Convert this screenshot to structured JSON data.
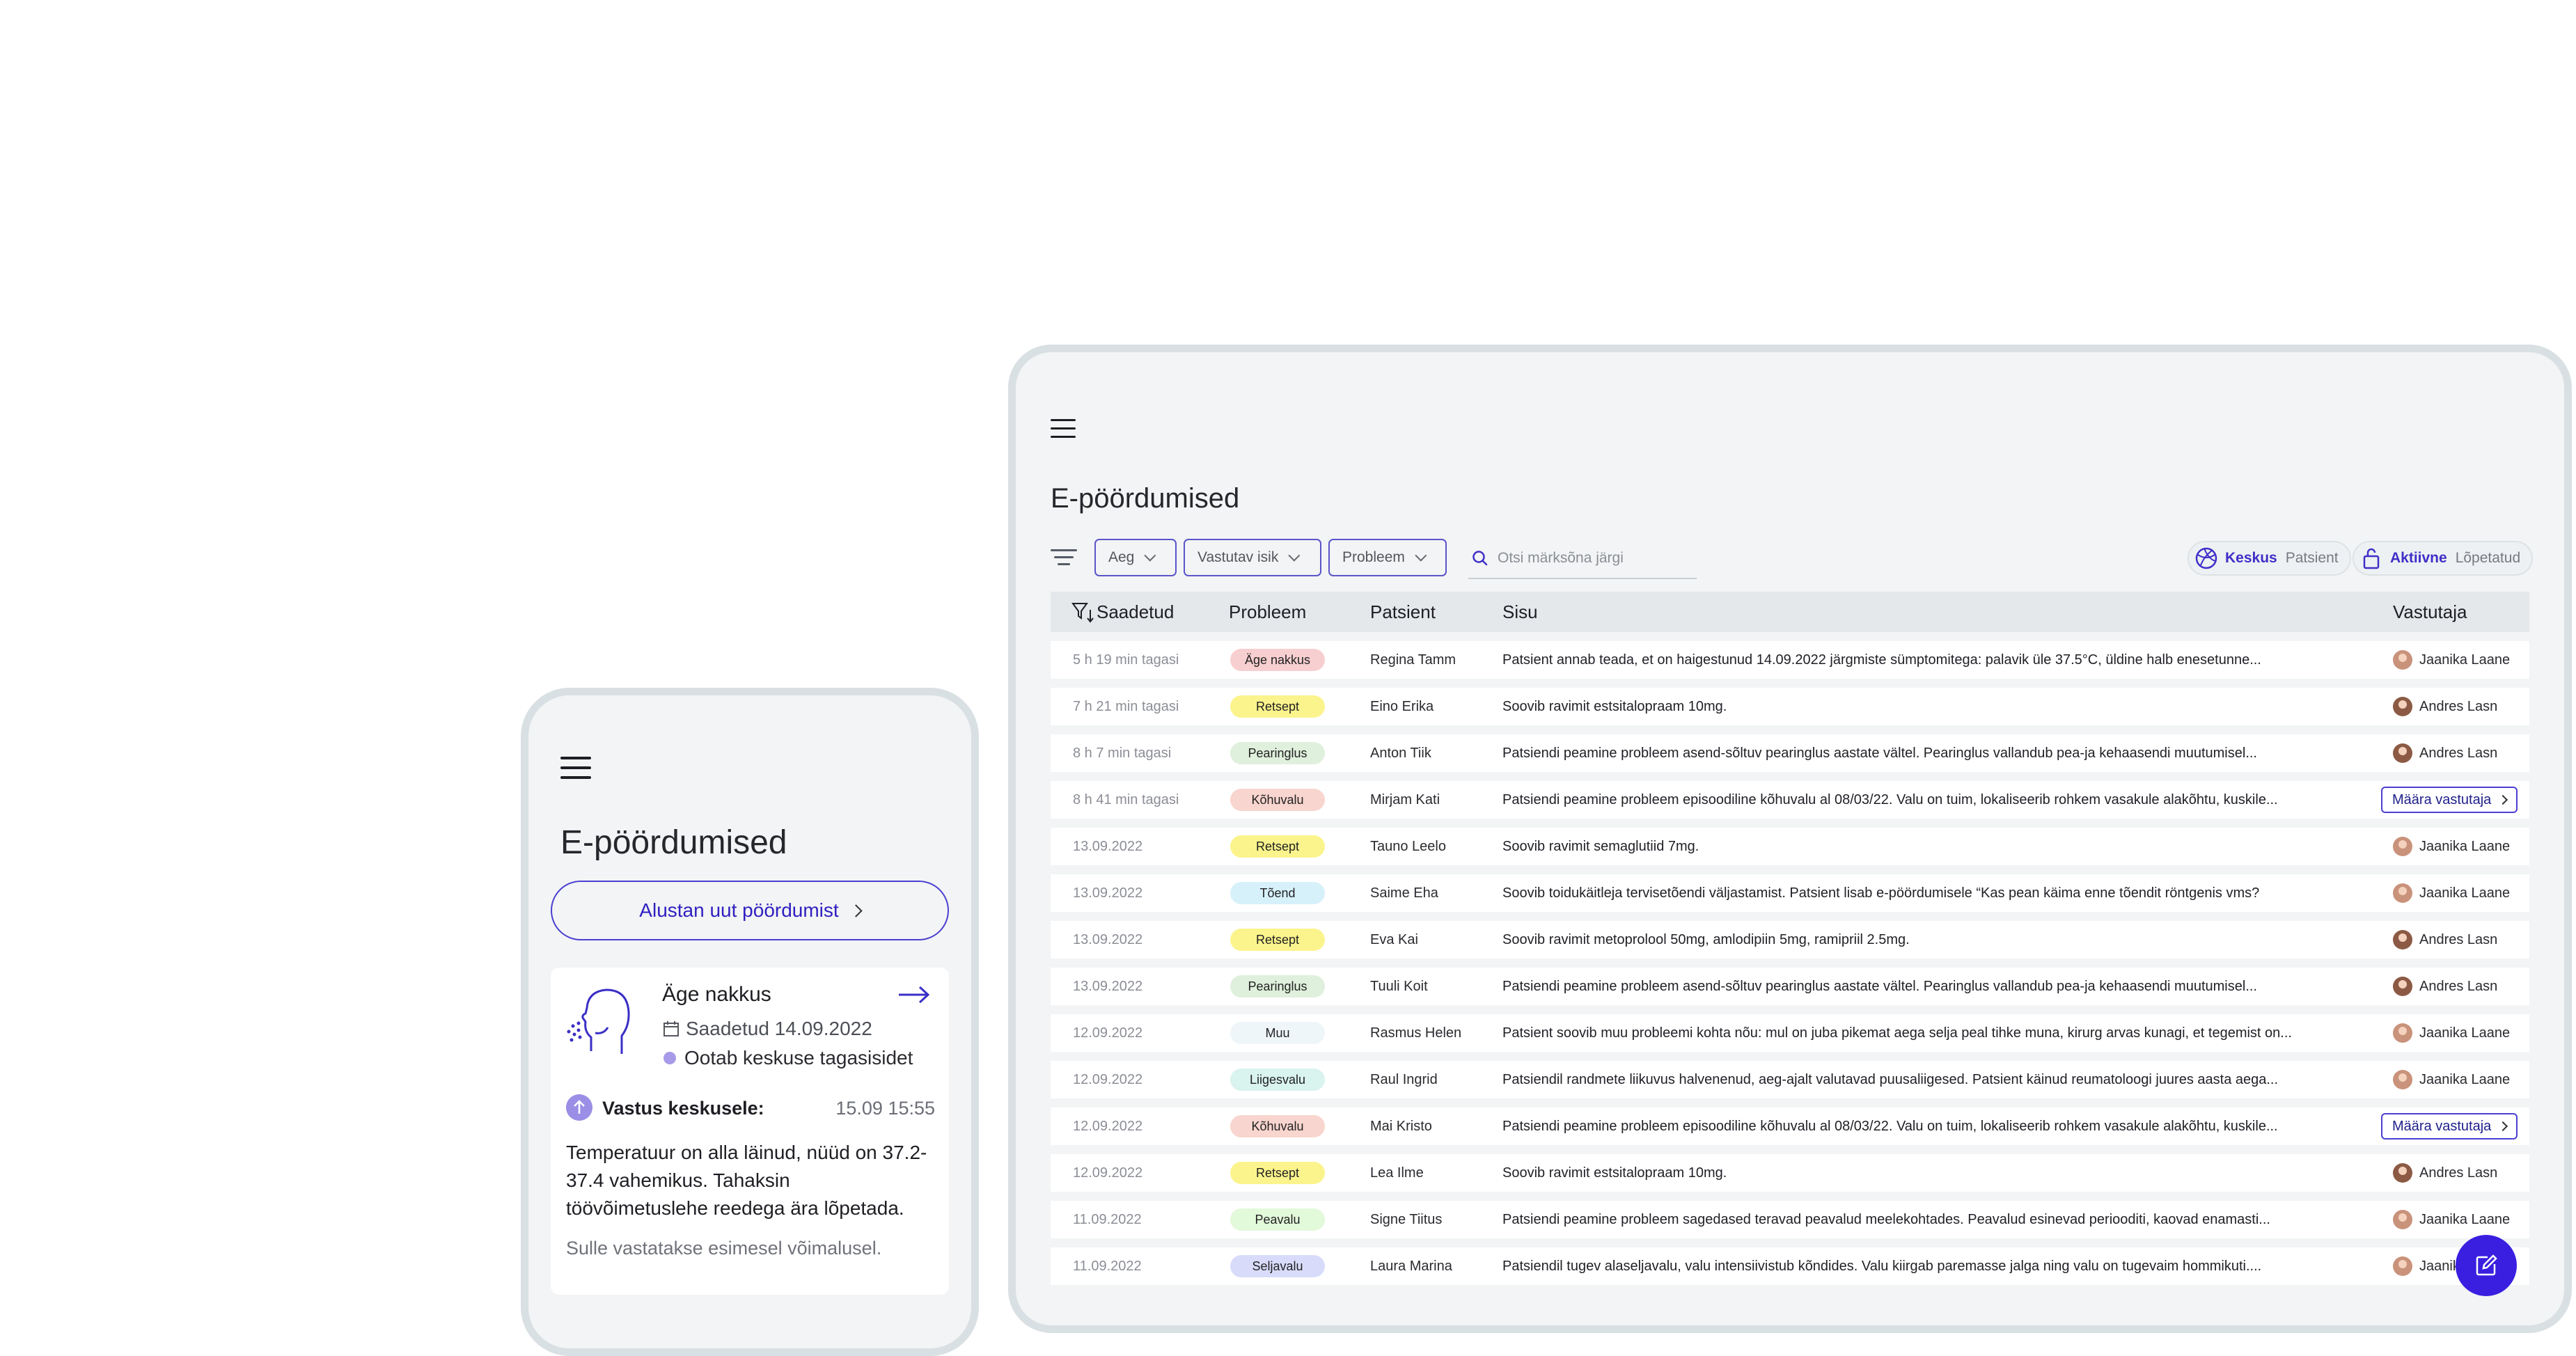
{
  "tablet": {
    "title": "E-pöördumised",
    "filters": [
      {
        "label": "Aeg"
      },
      {
        "label": "Vastutav isik"
      },
      {
        "label": "Probleem"
      }
    ],
    "search": {
      "placeholder": "Otsi märksõna järgi"
    },
    "toggles": [
      {
        "active": "Keskus",
        "inactive": "Patsient"
      },
      {
        "active": "Aktiivne",
        "inactive": "Lõpetatud"
      }
    ],
    "columns": {
      "saadetud": "Saadetud",
      "probleem": "Probleem",
      "patsient": "Patsient",
      "sisu": "Sisu",
      "vastutaja": "Vastutaja"
    },
    "rows": [
      {
        "time": "5 h 19 min tagasi",
        "problem": "Äge nakkus",
        "color": "#f8cfd0",
        "patient": "Regina Tamm",
        "content": "Patsient annab teada, et on haigestunud 14.09.2022 järgmiste sümptomitega: palavik üle 37.5°C, üldine halb enesetunne...",
        "responsible": "Jaanika Laane"
      },
      {
        "time": "7 h 21 min  tagasi",
        "problem": "Retsept",
        "color": "#fbf48c",
        "patient": "Eino Erika",
        "content": "Soovib ravimit estsitalopraam 10mg.",
        "responsible": "Andres Lasn"
      },
      {
        "time": "8 h 7 min  tagasi",
        "problem": "Pearinglus",
        "color": "#dff0dc",
        "patient": "Anton Tiik",
        "content": "Patsiendi peamine probleem asend-sõltuv pearinglus aastate vältel. Pearinglus vallandub pea-ja kehaasendi muutumisel...",
        "responsible": "Andres Lasn"
      },
      {
        "time": "8 h 41 min  tagasi",
        "problem": "Kõhuvalu",
        "color": "#f8d5ce",
        "patient": "Mirjam Kati",
        "content": "Patsiendi peamine probleem episoodiline kõhuvalu al 08/03/22. Valu on tuim, lokaliseerib rohkem vasakule alakõhtu, kuskile...",
        "responsible": "",
        "action": "Määra vastutaja"
      },
      {
        "time": "13.09.2022",
        "problem": "Retsept",
        "color": "#fbf48c",
        "patient": "Tauno Leelo",
        "content": "Soovib ravimit semaglutiid 7mg.",
        "responsible": "Jaanika Laane"
      },
      {
        "time": "13.09.2022",
        "problem": "Tõend",
        "color": "#d7f1fb",
        "patient": "Saime Eha",
        "content": "Soovib toidukäitleja tervisetõendi väljastamist. Patsient lisab e-pöördumisele “Kas pean käima enne tõendit röntgenis vms?",
        "responsible": "Jaanika Laane"
      },
      {
        "time": "13.09.2022",
        "problem": "Retsept",
        "color": "#fbf48c",
        "patient": "Eva Kai",
        "content": "Soovib ravimit metoprolool 50mg, amlodipiin 5mg, ramipriil 2.5mg.",
        "responsible": "Andres Lasn"
      },
      {
        "time": "13.09.2022",
        "problem": "Pearinglus",
        "color": "#dff0dc",
        "patient": "Tuuli Koit",
        "content": "Patsiendi peamine probleem asend-sõltuv pearinglus aastate vältel. Pearinglus vallandub pea-ja kehaasendi muutumisel...",
        "responsible": "Andres Lasn"
      },
      {
        "time": "12.09.2022",
        "problem": "Muu",
        "color": "#eef6fa",
        "patient": "Rasmus Helen",
        "content": "Patsient soovib muu probleemi kohta nõu: mul on juba pikemat aega selja peal tihke muna, kirurg arvas kunagi, et tegemist on...",
        "responsible": "Jaanika Laane"
      },
      {
        "time": "12.09.2022",
        "problem": "Liigesvalu",
        "color": "#d9f3ee",
        "patient": "Raul Ingrid",
        "content": "Patsiendil randmete liikuvus halvenenud, aeg-ajalt valutavad puusaliigesed. Patsient käinud reumatoloogi juures aasta aega...",
        "responsible": "Jaanika Laane"
      },
      {
        "time": "12.09.2022",
        "problem": "Kõhuvalu",
        "color": "#f8d5ce",
        "patient": "Mai Kristo",
        "content": "Patsiendi peamine probleem episoodiline kõhuvalu al 08/03/22. Valu on tuim, lokaliseerib rohkem vasakule alakõhtu, kuskile...",
        "responsible": "",
        "action": "Määra vastutaja"
      },
      {
        "time": "12.09.2022",
        "problem": "Retsept",
        "color": "#fbf48c",
        "patient": "Lea Ilme",
        "content": "Soovib ravimit estsitalopraam 10mg.",
        "responsible": "Andres Lasn"
      },
      {
        "time": "11.09.2022",
        "problem": "Peavalu",
        "color": "#e2f9da",
        "patient": "Signe Tiitus",
        "content": "Patsiendi peamine probleem sagedased teravad peavalud meelekohtades. Peavalud esinevad periooditi, kaovad enamasti...",
        "responsible": "Jaanika Laane"
      },
      {
        "time": "11.09.2022",
        "problem": "Seljavalu",
        "color": "#d8dcfa",
        "patient": "Laura Marina",
        "content": "Patsiendil tugev alaseljavalu, valu intensiivistub kõndides. Valu kiirgab paremasse jalga ning valu on tugevaim hommikuti....",
        "responsible": "Jaanika Laane"
      }
    ]
  },
  "phone": {
    "title": "E-pöördumised",
    "new_button": "Alustan uut pöördumist",
    "card": {
      "title": "Äge nakkus",
      "sent": "Saadetud 14.09.2022",
      "status": "Ootab keskuse tagasisidet",
      "reply_label": "Vastus keskusele:",
      "reply_date": "15.09  15:55",
      "reply_text": "Temperatuur on alla läinud, nüüd on 37.2-37.4 vahemikus. Tahaksin töövõimetuslehe reedega ära lõpetada.",
      "note": "Sulle vastatakse esimesel võimalusel."
    }
  }
}
